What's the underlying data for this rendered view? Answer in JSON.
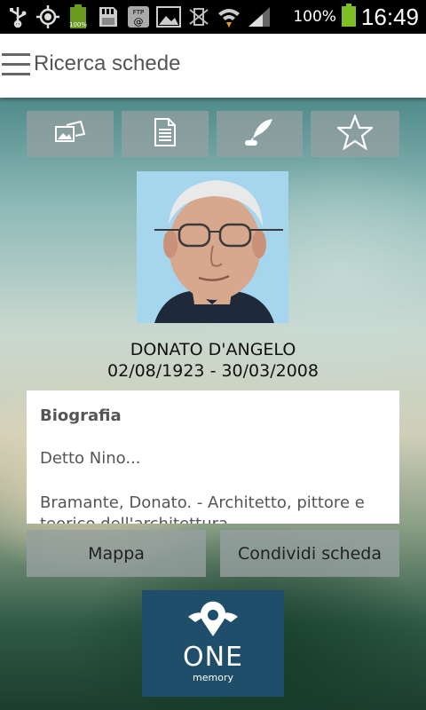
{
  "status_bar": {
    "battery_percent": "100%",
    "time": "16:49",
    "icons": [
      "usb-icon",
      "gps-icon",
      "battery-full-icon",
      "sd-card-icon",
      "ftp-icon",
      "image-icon",
      "vibrate-icon",
      "wifi-icon",
      "signal-icon",
      "battery-icon"
    ]
  },
  "app_bar": {
    "title": "Ricerca schede"
  },
  "tabs": [
    {
      "icon": "photos-icon"
    },
    {
      "icon": "document-icon"
    },
    {
      "icon": "quill-icon"
    },
    {
      "icon": "star-icon"
    }
  ],
  "person": {
    "name": "DONATO D'ANGELO",
    "dates": "02/08/1923 - 30/03/2008"
  },
  "bio": {
    "title": "Biografia",
    "paragraph1": "Detto Nino...",
    "paragraph2": "Bramante, Donato. - Architetto, pittore e teorico dell'architettura..."
  },
  "actions": {
    "map_label": "Mappa",
    "share_label": "Condividi scheda"
  },
  "logo": {
    "line1": "ONE",
    "line2": "memory"
  },
  "colors": {
    "logo_bg": "#1e4e6a",
    "button_bg": "#96a0a0"
  }
}
